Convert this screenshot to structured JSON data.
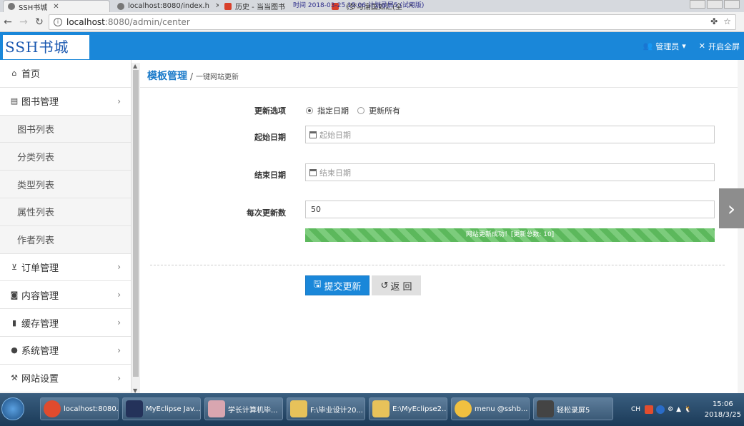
{
  "browser": {
    "tabs": [
      {
        "title": "SSH书城",
        "active": true
      },
      {
        "title": "localhost:8080/index.h",
        "active": false
      },
      {
        "title": "历史 - 当当图书",
        "active": false
      },
      {
        "title": "《梦与席国如汇(全",
        "active": false
      }
    ],
    "overlay_text": "时间 2018-03-25 15:06 计划录屏5 (试用版)",
    "url_host": "localhost",
    "url_path": ":8080/admin/center"
  },
  "app": {
    "logo": "SSH书城",
    "header": {
      "admin_label": "管理员",
      "fullscreen_label": "开启全屏"
    }
  },
  "sidebar": {
    "items": [
      {
        "label": "首页",
        "icon": "home-icon",
        "glyph": "⌂"
      },
      {
        "label": "图书管理",
        "icon": "book-icon",
        "glyph": "▤",
        "chevron": "›"
      },
      {
        "label": "图书列表",
        "sub": true
      },
      {
        "label": "分类列表",
        "sub": true
      },
      {
        "label": "类型列表",
        "sub": true
      },
      {
        "label": "属性列表",
        "sub": true
      },
      {
        "label": "作者列表",
        "sub": true
      },
      {
        "label": "订单管理",
        "icon": "cart-icon",
        "glyph": "⊻",
        "chevron": "›"
      },
      {
        "label": "内容管理",
        "icon": "rss-icon",
        "glyph": "◙",
        "chevron": "›"
      },
      {
        "label": "缓存管理",
        "icon": "file-icon",
        "glyph": "▮",
        "chevron": "›"
      },
      {
        "label": "系统管理",
        "icon": "user-icon",
        "glyph": "●",
        "chevron": "›"
      },
      {
        "label": "网站设置",
        "icon": "wrench-icon",
        "glyph": "⚒",
        "chevron": "›"
      }
    ]
  },
  "main": {
    "title": "模板管理",
    "separator": "/",
    "subtitle": "一键网站更新",
    "form": {
      "update_option_label": "更新选项",
      "radio_options": [
        {
          "label": "指定日期",
          "checked": true
        },
        {
          "label": "更新所有",
          "checked": false
        }
      ],
      "start_date_label": "起始日期",
      "start_date_placeholder": "起始日期",
      "end_date_label": "结束日期",
      "end_date_placeholder": "结束日期",
      "per_update_label": "每次更新数",
      "per_update_value": "50",
      "progress_text": "网站更新成功！[更新总数: 10]",
      "progress_percent": 100,
      "submit_label": "提交更新",
      "back_label": "返 回"
    }
  },
  "taskbar": {
    "tasks": [
      {
        "label": "localhost:8080...",
        "color": "#e04b2e"
      },
      {
        "label": "MyEclipse Jav...",
        "color": "#24325a"
      },
      {
        "label": "学长计算机毕...",
        "color": "#d9a6b0"
      },
      {
        "label": "F:\\毕业设计20...",
        "color": "#e7c25a"
      },
      {
        "label": "E:\\MyEclipse2...",
        "color": "#e7c25a"
      },
      {
        "label": "menu @sshb...",
        "color": "#f0c040"
      },
      {
        "label": "轻松录屏5",
        "color": "#444444"
      }
    ],
    "tray_lang": "CH",
    "time": "15:06",
    "date": "2018/3/25"
  },
  "colors": {
    "brand_blue": "#1a87d9",
    "progress_green": "#5cb85c"
  }
}
